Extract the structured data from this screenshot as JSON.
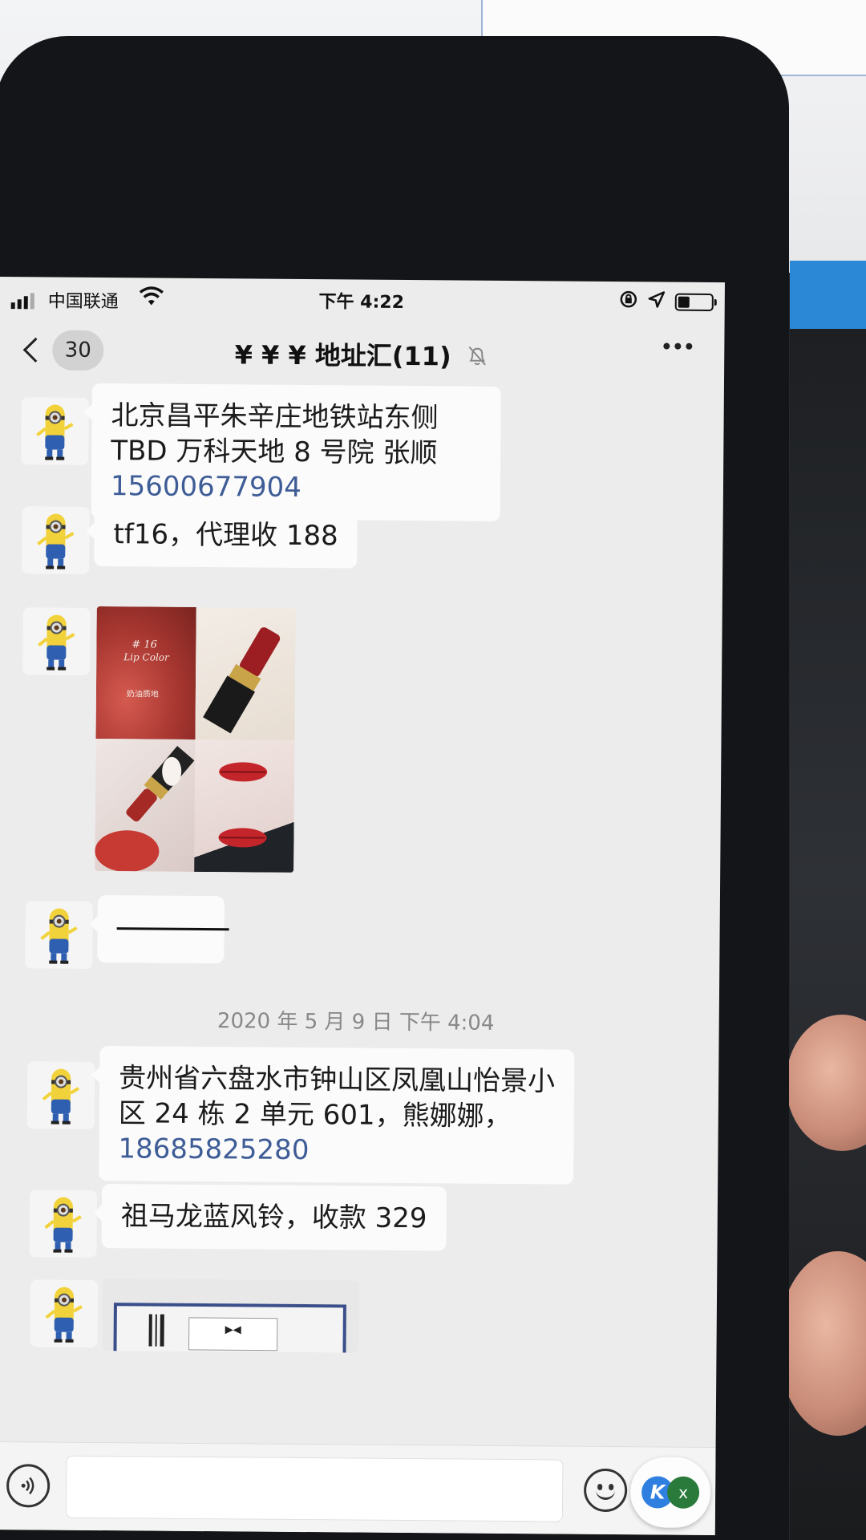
{
  "statusbar": {
    "carrier": "中国联通",
    "time": "下午 4:22"
  },
  "navbar": {
    "unread_count": "30",
    "title": "¥ ¥ ¥ 地址汇(11)"
  },
  "messages": [
    {
      "type": "text",
      "text": "北京昌平朱辛庄地铁站东侧 TBD 万科天地 8 号院 张顺 ",
      "phone": "15600677904"
    },
    {
      "type": "text",
      "text": "tf16，代理收 188"
    },
    {
      "type": "image",
      "caption_number": "# 16",
      "caption_title": "Lip Color",
      "caption_cn": "奶油质地"
    },
    {
      "type": "text",
      "text": ""
    },
    {
      "type": "timestamp",
      "text": "2020 年 5 月 9 日 下午 4:04"
    },
    {
      "type": "text",
      "text": "贵州省六盘水市钟山区凤凰山怡景小区 24 栋 2 单元 601，熊娜娜，",
      "phone": "18685825280"
    },
    {
      "type": "text",
      "text": "祖马龙蓝风铃，收款 329"
    },
    {
      "type": "image"
    }
  ],
  "inputbar": {
    "floating_badge_1": "K",
    "floating_badge_2": "x"
  }
}
